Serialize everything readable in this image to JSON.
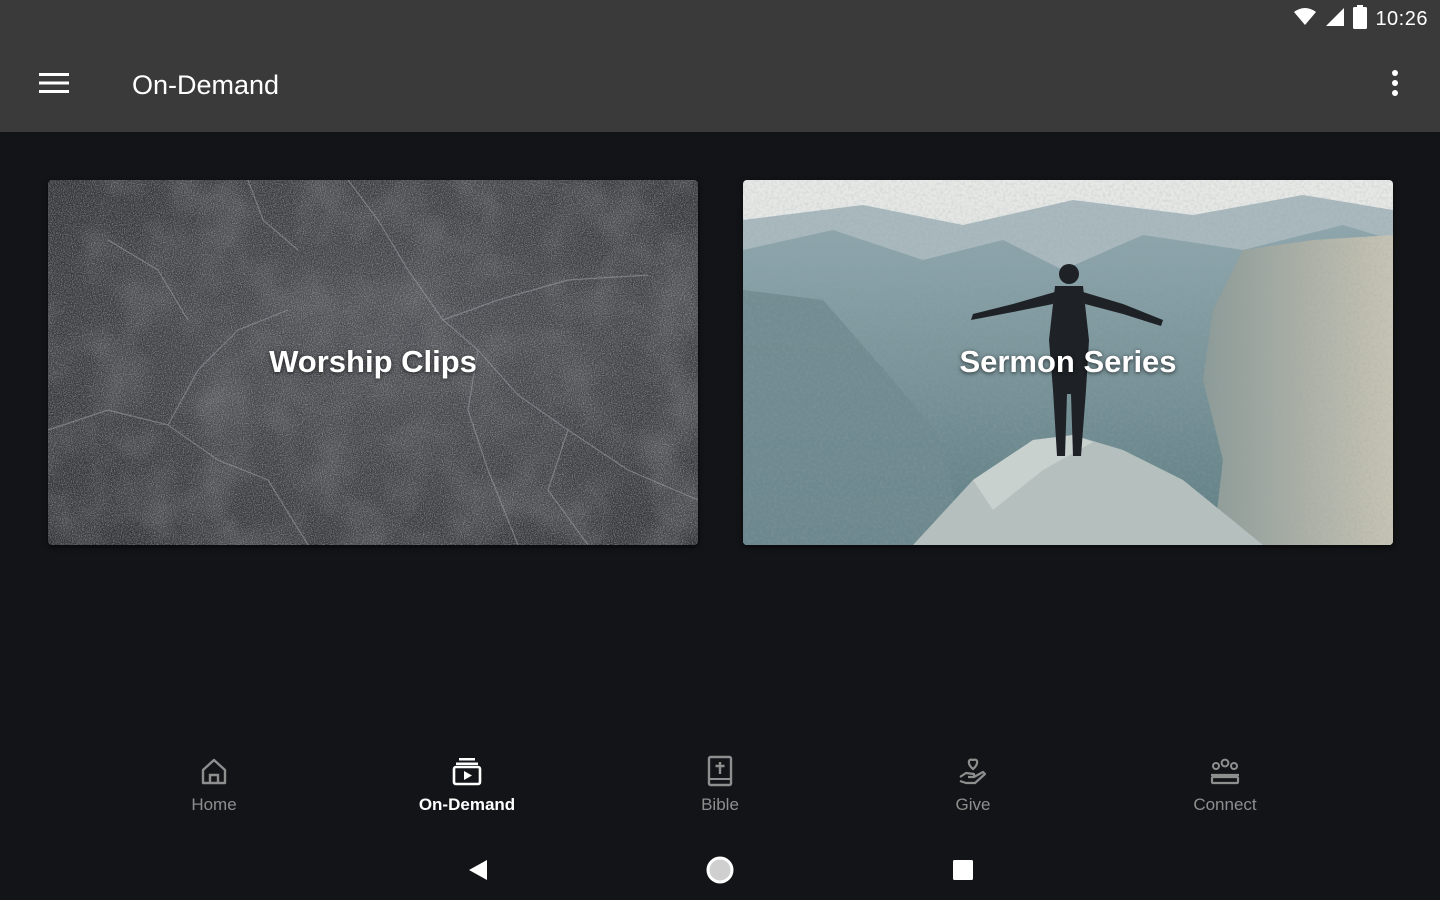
{
  "status_bar": {
    "time": "10:26",
    "icons": [
      "wifi-icon",
      "cellular-signal-icon",
      "battery-icon"
    ]
  },
  "app_bar": {
    "title": "On-Demand",
    "menu_icon": "hamburger-menu-icon",
    "overflow_icon": "more-vert-icon"
  },
  "cards": [
    {
      "title": "Worship Clips",
      "image": "cracked-stone-texture"
    },
    {
      "title": "Sermon Series",
      "image": "person-on-mountain-peak"
    }
  ],
  "bottom_nav": {
    "items": [
      {
        "label": "Home",
        "icon": "home-icon",
        "active": false
      },
      {
        "label": "On-Demand",
        "icon": "on-demand-video-icon",
        "active": true
      },
      {
        "label": "Bible",
        "icon": "bible-icon",
        "active": false
      },
      {
        "label": "Give",
        "icon": "give-hand-heart-icon",
        "active": false
      },
      {
        "label": "Connect",
        "icon": "connect-people-icon",
        "active": false
      }
    ]
  },
  "system_nav": {
    "buttons": [
      "back-icon",
      "home-circle-icon",
      "recents-square-icon"
    ]
  },
  "colors": {
    "app_bar": "#3a3a3a",
    "background": "#131417",
    "active_label": "#ffffff",
    "inactive_label": "#8e8e8e"
  }
}
